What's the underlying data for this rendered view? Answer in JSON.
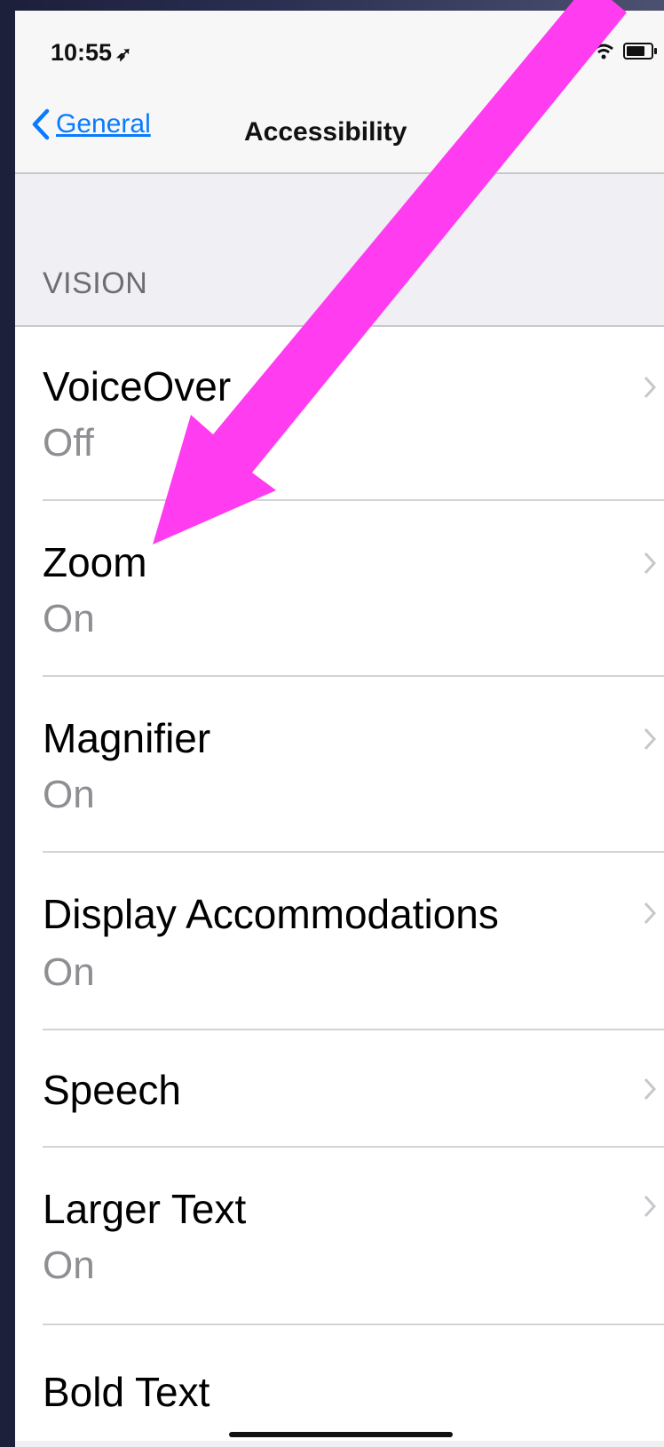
{
  "status": {
    "time": "10:55"
  },
  "nav": {
    "back_label": "General",
    "title": "Accessibility"
  },
  "section": {
    "header": "VISION"
  },
  "rows": [
    {
      "label": "VoiceOver",
      "value": "Off"
    },
    {
      "label": "Zoom",
      "value": "On"
    },
    {
      "label": "Magnifier",
      "value": "On"
    },
    {
      "label": "Display Accommodations",
      "value": "On"
    },
    {
      "label": "Speech"
    },
    {
      "label": "Larger Text",
      "value": "On"
    },
    {
      "label": "Bold Text"
    }
  ],
  "colors": {
    "accent": "#0a7aff",
    "annotation_arrow": "#ff3cf0"
  }
}
